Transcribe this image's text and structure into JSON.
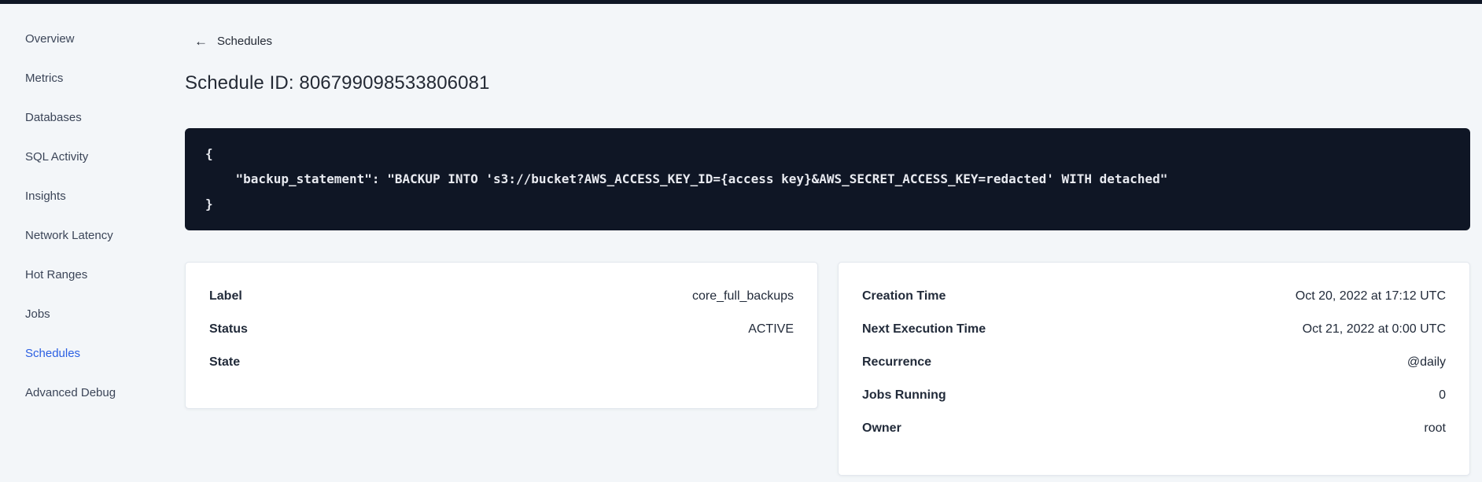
{
  "top_strip_color": "#0f1625",
  "sidebar": {
    "items": [
      {
        "label": "Overview",
        "active": false
      },
      {
        "label": "Metrics",
        "active": false
      },
      {
        "label": "Databases",
        "active": false
      },
      {
        "label": "SQL Activity",
        "active": false
      },
      {
        "label": "Insights",
        "active": false
      },
      {
        "label": "Network Latency",
        "active": false
      },
      {
        "label": "Hot Ranges",
        "active": false
      },
      {
        "label": "Jobs",
        "active": false
      },
      {
        "label": "Schedules",
        "active": true
      },
      {
        "label": "Advanced Debug",
        "active": false
      }
    ],
    "active_color": "#2b5fe2"
  },
  "header": {
    "back_icon": "←",
    "back_label": "Schedules",
    "title": "Schedule ID: 806799098533806081"
  },
  "code_block": {
    "lines": {
      "0": "{",
      "1": "    \"backup_statement\": \"BACKUP INTO 's3://bucket?AWS_ACCESS_KEY_ID={access key}&AWS_SECRET_ACCESS_KEY=redacted' WITH detached\"",
      "2": "}"
    },
    "background": "#0f1625"
  },
  "schedule_card": {
    "rows": {
      "0": {
        "label": "Label",
        "value": "core_full_backups"
      },
      "1": {
        "label": "Status",
        "value": "ACTIVE"
      },
      "2": {
        "label": "State",
        "value": ""
      }
    }
  },
  "details_card": {
    "rows": {
      "0": {
        "label": "Creation Time",
        "value": "Oct 20, 2022 at 17:12 UTC"
      },
      "1": {
        "label": "Next Execution Time",
        "value": "Oct 21, 2022 at 0:00 UTC"
      },
      "2": {
        "label": "Recurrence",
        "value": "@daily"
      },
      "3": {
        "label": "Jobs Running",
        "value": "0"
      },
      "4": {
        "label": "Owner",
        "value": "root"
      }
    }
  }
}
